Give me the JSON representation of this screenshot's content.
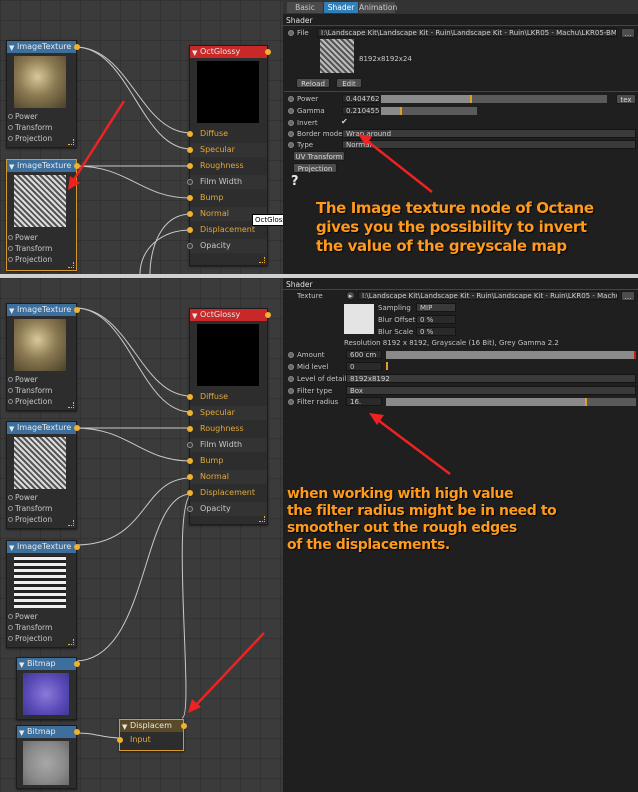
{
  "top": {
    "image_texture_1": {
      "title": "ImageTexture",
      "ports": [
        "Power",
        "Transform",
        "Projection"
      ]
    },
    "image_texture_2": {
      "title": "ImageTexture",
      "ports": [
        "Power",
        "Transform",
        "Projection"
      ]
    },
    "glossy": {
      "title": "OctGlossy",
      "ports": [
        "Diffuse",
        "Specular",
        "Roughness",
        "Film Width",
        "Bump",
        "Normal",
        "Displacement",
        "Opacity"
      ],
      "tooltip": "OctGlossy"
    },
    "tabs": [
      "Basic",
      "Shader",
      "Animation"
    ],
    "shader_label": "Shader",
    "file_label": "File",
    "file_path": "I:\\Landscape Kit\\Landscape Kit - Ruin\\Landscape Kit - Ruin\\LKR05 - Machu\\LKR05-BM02-Flow.jpg",
    "file_btn": "...",
    "image_info": "8192x8192x24",
    "reload": "Reload",
    "edit": "Edit",
    "power_label": "Power",
    "power_value": "0.404762",
    "power_level": 0.4,
    "tex_btn": "tex",
    "gamma_label": "Gamma",
    "gamma_value": "0.210455",
    "gamma_level": 0.21,
    "invert_label": "Invert",
    "invert_check": "✔",
    "border_label": "Border mode",
    "border_value": "Wrap around",
    "type_label": "Type",
    "type_value": "Normal",
    "uv_btn": "UV Transform",
    "proj_btn": "Projection",
    "help": "?",
    "annotation": [
      "The Image texture node of Octane",
      "gives you the possibility to invert",
      "the value of the greyscale map"
    ]
  },
  "bottom": {
    "image_texture_1": {
      "title": "ImageTexture",
      "ports": [
        "Power",
        "Transform",
        "Projection"
      ]
    },
    "image_texture_2": {
      "title": "ImageTexture",
      "ports": [
        "Power",
        "Transform",
        "Projection"
      ]
    },
    "image_texture_3": {
      "title": "ImageTexture",
      "ports": [
        "Power",
        "Transform",
        "Projection"
      ]
    },
    "bitmap_1": {
      "title": "Bitmap"
    },
    "bitmap_2": {
      "title": "Bitmap"
    },
    "displacement": {
      "title": "Displacem",
      "port": "Input"
    },
    "glossy": {
      "title": "OctGlossy",
      "ports": [
        "Diffuse",
        "Specular",
        "Roughness",
        "Film Width",
        "Bump",
        "Normal",
        "Displacement",
        "Opacity"
      ]
    },
    "shader_label": "Shader",
    "texture_label": "Texture",
    "texture_path": "I:\\Landscape Kit\\Landscape Kit - Ruin\\Landscape Kit - Ruin\\LKR05 - Machu\\LKR05-B",
    "texture_btn": "...",
    "sampling_label": "Sampling",
    "sampling_value": "MIP",
    "blur_offset_label": "Blur Offset",
    "blur_offset_value": "0 %",
    "blur_scale_label": "Blur Scale",
    "blur_scale_value": "0 %",
    "resolution": "Resolution 8192 x 8192, Grayscale (16 Bit), Grey Gamma 2.2",
    "amount_label": "Amount",
    "amount_value": "600 cm",
    "mid_label": "Mid level",
    "mid_value": "0",
    "lod_label": "Level of details",
    "lod_value": "8192x8192",
    "filter_type_label": "Filter type",
    "filter_type_value": "Box",
    "filter_radius_label": "Filter radius",
    "filter_radius_value": "16.",
    "filter_radius_level": 0.8,
    "annotation": [
      "when working with high value",
      "the filter radius might be in need to",
      "smoother out the rough edges",
      "of the displacements."
    ]
  },
  "colors": {
    "annotation": "#ff9a1c",
    "arrow": "#ee2222",
    "wire": "#c8c8c8",
    "accent": "#f0b030"
  }
}
